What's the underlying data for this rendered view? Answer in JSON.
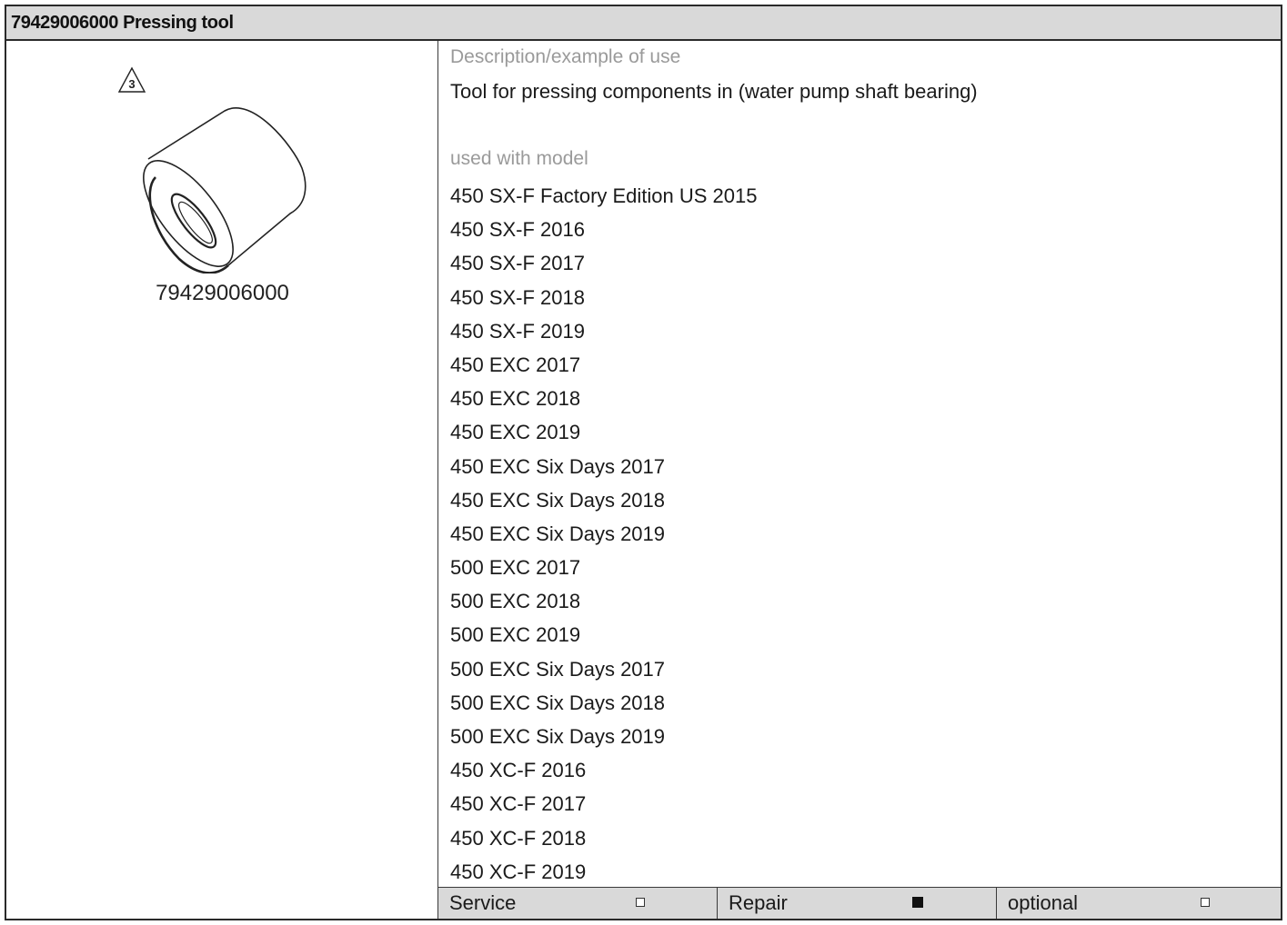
{
  "header": {
    "title": "79429006000 Pressing tool"
  },
  "figure": {
    "callout_number": "3",
    "part_number": "79429006000"
  },
  "description": {
    "label": "Description/example of use",
    "text": "Tool for pressing components in (water pump shaft bearing)"
  },
  "models": {
    "label": "used with model",
    "items": [
      "450 SX-F Factory Edition US 2015",
      "450 SX-F 2016",
      "450 SX-F 2017",
      "450 SX-F 2018",
      "450 SX-F 2019",
      "450 EXC 2017",
      "450 EXC 2018",
      "450 EXC 2019",
      "450 EXC Six Days 2017",
      "450 EXC Six Days 2018",
      "450 EXC Six Days 2019",
      "500 EXC 2017",
      "500 EXC 2018",
      "500 EXC 2019",
      "500 EXC Six Days 2017",
      "500 EXC Six Days 2018",
      "500 EXC Six Days 2019",
      "450 XC-F 2016",
      "450 XC-F 2017",
      "450 XC-F 2018",
      "450 XC-F 2019"
    ]
  },
  "footer": {
    "service": {
      "label": "Service",
      "checked": false
    },
    "repair": {
      "label": "Repair",
      "checked": true
    },
    "optional": {
      "label": "optional",
      "checked": false
    }
  }
}
